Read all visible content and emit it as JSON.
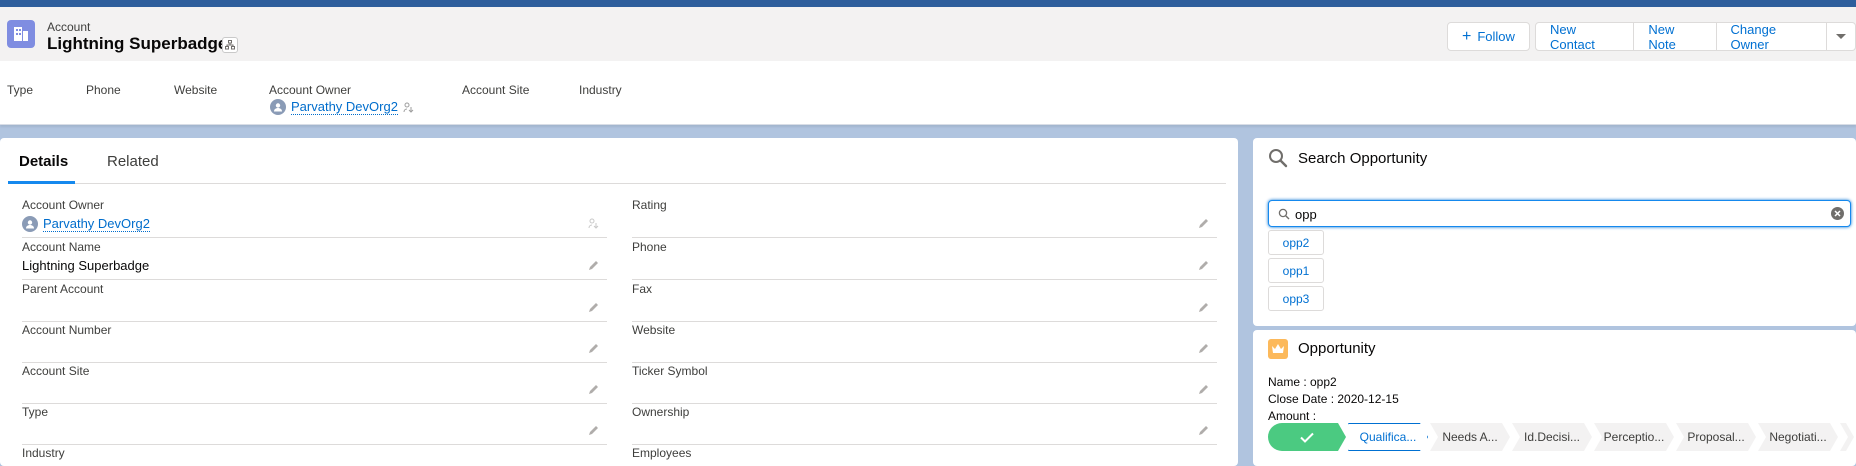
{
  "record": {
    "object_label": "Account",
    "name": "Lightning Superbadge"
  },
  "actions": {
    "follow": "Follow",
    "new_contact": "New Contact",
    "new_note": "New Note",
    "change_owner": "Change Owner"
  },
  "highlights": {
    "type_label": "Type",
    "phone_label": "Phone",
    "website_label": "Website",
    "owner_label": "Account Owner",
    "owner_value": "Parvathy DevOrg2",
    "site_label": "Account Site",
    "industry_label": "Industry"
  },
  "tabs": {
    "details": "Details",
    "related": "Related"
  },
  "left_fields": [
    {
      "label": "Account Owner",
      "value": "Parvathy DevOrg2"
    },
    {
      "label": "Account Name",
      "value": "Lightning Superbadge"
    },
    {
      "label": "Parent Account",
      "value": ""
    },
    {
      "label": "Account Number",
      "value": ""
    },
    {
      "label": "Account Site",
      "value": ""
    },
    {
      "label": "Type",
      "value": ""
    },
    {
      "label": "Industry",
      "value": ""
    }
  ],
  "right_fields": [
    {
      "label": "Rating",
      "value": ""
    },
    {
      "label": "Phone",
      "value": ""
    },
    {
      "label": "Fax",
      "value": ""
    },
    {
      "label": "Website",
      "value": ""
    },
    {
      "label": "Ticker Symbol",
      "value": ""
    },
    {
      "label": "Ownership",
      "value": ""
    },
    {
      "label": "Employees",
      "value": ""
    }
  ],
  "search_panel": {
    "title": "Search Opportunity",
    "query": "opp",
    "results": [
      "opp2",
      "opp1",
      "opp3"
    ]
  },
  "opportunity_panel": {
    "title": "Opportunity",
    "name_line": "Name : opp2",
    "close_date_line": "Close Date : 2020-12-15",
    "amount_line": "Amount :",
    "stages": [
      "Qualifica...",
      "Needs A...",
      "Id.Decisi...",
      "Perceptio...",
      "Proposal...",
      "Negotiati..."
    ]
  },
  "colors": {
    "brand_blue": "#0070d2",
    "account_icon": "#7f8de1",
    "opportunity_icon": "#fcb95b",
    "path_complete": "#4bca81"
  },
  "icons": [
    "account-icon",
    "hierarchy-icon",
    "add-icon",
    "chevron-down-icon",
    "avatar-icon",
    "owner-change-icon",
    "edit-icon",
    "search-icon",
    "clear-icon",
    "opportunity-icon",
    "check-icon"
  ]
}
